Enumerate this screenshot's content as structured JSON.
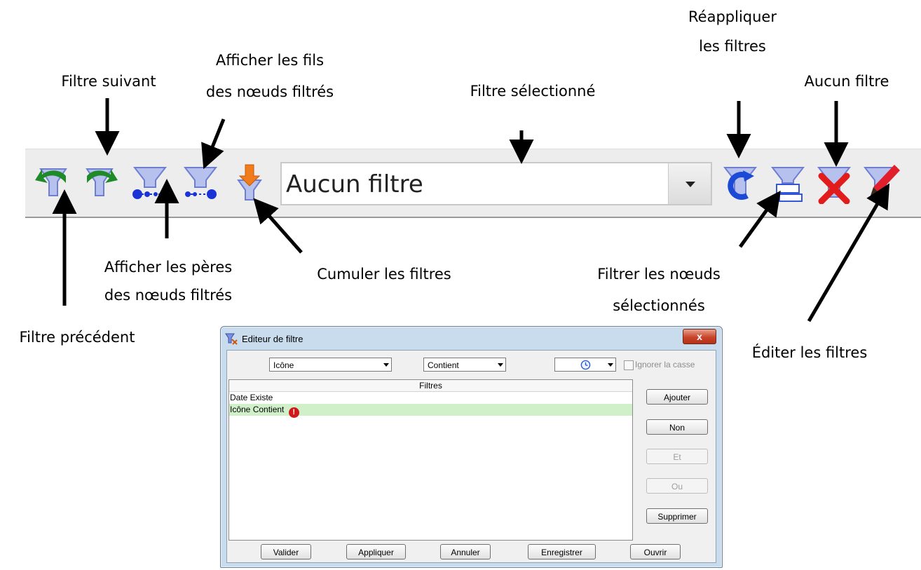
{
  "annotations": {
    "filtre_suivant": "Filtre suivant",
    "afficher_fils": [
      "Afficher les fils",
      "des nœuds filtrés"
    ],
    "filtre_selectionne": "Filtre sélectionné",
    "reappliquer": [
      "Réappliquer",
      "les filtres"
    ],
    "aucun_filtre": "Aucun filtre",
    "afficher_peres": [
      "Afficher les pères",
      "des nœuds filtrés"
    ],
    "cumuler": "Cumuler les filtres",
    "filtrer_noeuds": [
      "Filtrer les nœuds",
      "sélectionnés"
    ],
    "filtre_precedent": "Filtre précédent",
    "editer": "Éditer les filtres"
  },
  "toolbar": {
    "combo_value": "Aucun filtre",
    "buttons": [
      "previous-filter",
      "next-filter",
      "show-parents",
      "show-children",
      "cumulate-filters",
      "reapply-filters",
      "filter-selected-nodes",
      "no-filter",
      "edit-filters"
    ]
  },
  "dialog": {
    "title": "Editeur de filtre",
    "close": "x",
    "field_select": "Icône",
    "operator_select": "Contient",
    "value_select_icon": "clock-icon",
    "ignore_case_label": "Ignorer la casse",
    "list_header": "Filtres",
    "rows": [
      "Date Existe",
      "Icône Contient"
    ],
    "side_buttons": {
      "add": "Ajouter",
      "not": "Non",
      "and": "Et",
      "or": "Ou",
      "delete": "Supprimer"
    },
    "bottom_buttons": {
      "validate": "Valider",
      "apply": "Appliquer",
      "cancel": "Annuler",
      "save": "Enregistrer",
      "open": "Ouvrir"
    }
  },
  "colors": {
    "arrow": "#000000",
    "funnel": "#7c8fe0",
    "green_arrow": "#1f8a2a",
    "orange_arrow": "#f07c1c",
    "red_x": "#e21b1b",
    "selected_row": "#cff0c9"
  }
}
